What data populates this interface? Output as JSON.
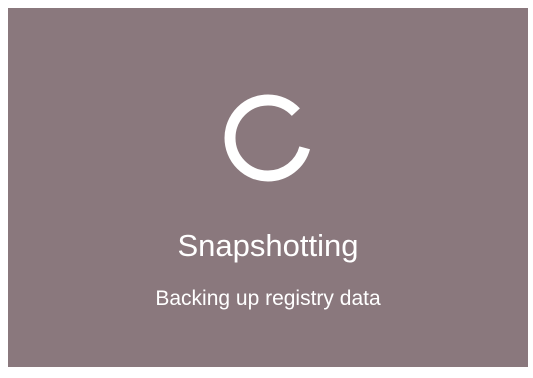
{
  "dialog": {
    "title": "Snapshotting",
    "message": "Backing up registry data",
    "spinner_icon": "loading-spinner-icon"
  },
  "colors": {
    "panel_background": "#8a787d",
    "foreground": "#ffffff"
  }
}
